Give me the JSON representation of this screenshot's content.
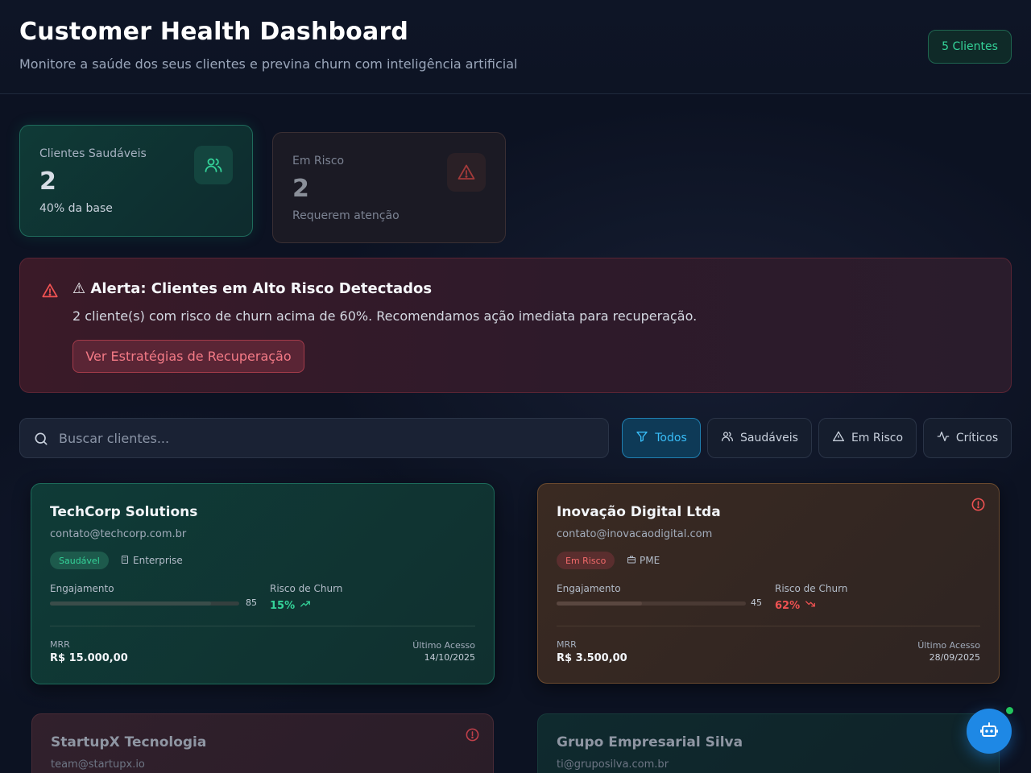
{
  "header": {
    "title": "Customer Health Dashboard",
    "subtitle": "Monitore a saúde dos seus clientes e previna churn com inteligência artificial",
    "client_count": "5 Clientes"
  },
  "stats": {
    "healthy": {
      "label": "Clientes Saudáveis",
      "value": "2",
      "note": "40% da base",
      "icon": "users-icon"
    },
    "risk": {
      "label": "Em Risco",
      "value": "2",
      "note": "Requerem atenção",
      "icon": "warning-triangle-icon"
    }
  },
  "alert": {
    "title": "⚠ Alerta: Clientes em Alto Risco Detectados",
    "text": "2 cliente(s) com risco de churn acima de 60%. Recomendamos ação imediata para recuperação.",
    "button_label": "Ver Estratégias de Recuperação"
  },
  "search": {
    "placeholder": "Buscar clientes...",
    "value": ""
  },
  "filters": [
    {
      "label": "Todos",
      "icon": "filter-icon",
      "active": true
    },
    {
      "label": "Saudáveis",
      "icon": "users-icon",
      "active": false
    },
    {
      "label": "Em Risco",
      "icon": "warning-triangle-icon",
      "active": false
    },
    {
      "label": "Críticos",
      "icon": "activity-icon",
      "active": false
    }
  ],
  "clients": [
    {
      "name": "TechCorp Solutions",
      "email": "contato@techcorp.com.br",
      "status": "Saudável",
      "plan": "Enterprise",
      "engagement_label": "Engajamento",
      "engagement": 85,
      "churn_label": "Risco de Churn",
      "churn": "15%",
      "mrr_label": "MRR",
      "mrr": "R$ 15.000,00",
      "access_label": "Último Acesso",
      "last_access": "14/10/2025"
    },
    {
      "name": "Inovação Digital Ltda",
      "email": "contato@inovacaodigital.com",
      "status": "Em Risco",
      "plan": "PME",
      "engagement_label": "Engajamento",
      "engagement": 45,
      "churn_label": "Risco de Churn",
      "churn": "62%",
      "mrr_label": "MRR",
      "mrr": "R$ 3.500,00",
      "access_label": "Último Acesso",
      "last_access": "28/09/2025"
    },
    {
      "name": "StartupX Tecnologia",
      "email": "team@startupx.io"
    },
    {
      "name": "Grupo Empresarial Silva",
      "email": "ti@gruposilva.com.br"
    }
  ],
  "colors": {
    "accent_healthy": "#34d399",
    "accent_risk": "#f05252",
    "accent_active": "#38bdf8",
    "fab": "#1e88e5"
  }
}
